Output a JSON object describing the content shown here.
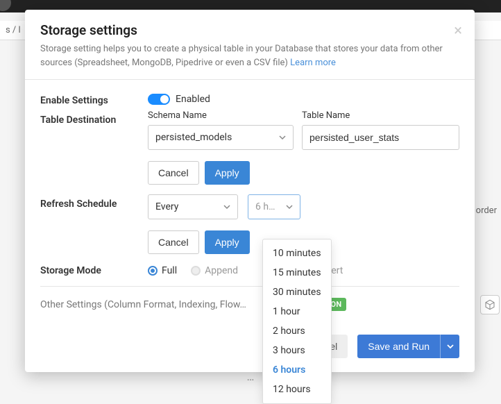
{
  "modal": {
    "title": "Storage settings",
    "subtitle": "Storage setting helps you to create a physical table in your Database that stores your data from other sources (Spreadsheet, MongoDB, Pipedrive or even a CSV file)",
    "learn_more": "Learn more"
  },
  "enable": {
    "label": "Enable Settings",
    "state_label": "Enabled"
  },
  "destination": {
    "label": "Table Destination",
    "schema_label": "Schema Name",
    "schema_value": "persisted_models",
    "table_label": "Table Name",
    "table_value": "persisted_user_stats",
    "cancel": "Cancel",
    "apply": "Apply"
  },
  "refresh": {
    "label": "Refresh Schedule",
    "frequency": "Every",
    "interval_display": "6 ho…",
    "cancel": "Cancel",
    "apply": "Apply",
    "options": [
      "10 minutes",
      "15 minutes",
      "30 minutes",
      "1 hour",
      "2 hours",
      "3 hours",
      "6 hours",
      "12 hours"
    ],
    "active_option": "6 hours"
  },
  "storage_mode": {
    "label": "Storage Mode",
    "options": [
      "Full",
      "Append",
      "Upsert"
    ],
    "selected": "Full"
  },
  "other": {
    "text": "Other Settings (Column Format, Indexing, Flow…",
    "badge": "COMING SOON"
  },
  "footer": {
    "cancel": "Cancel",
    "save_run": "Save and Run"
  },
  "bg": {
    "breadcrumb_fragment": "s / l",
    "right_label": "order",
    "ellipsis": "…"
  }
}
